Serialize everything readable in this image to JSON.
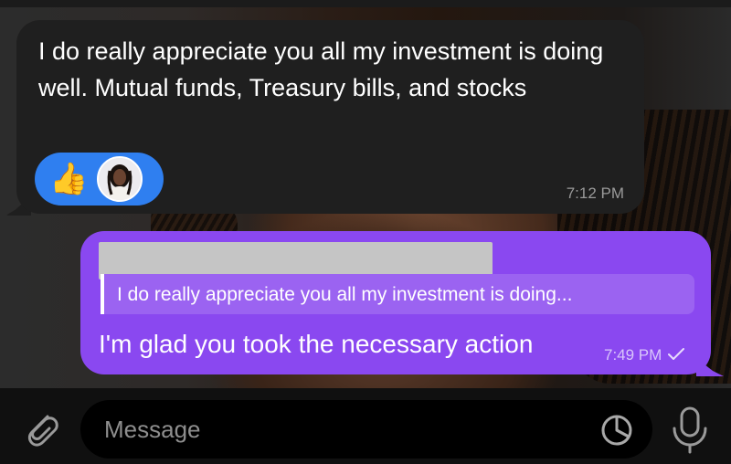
{
  "chat": {
    "incoming": {
      "text": "I do really appreciate you all my investment is doing well. Mutual funds, Treasury bills, and stocks",
      "time": "7:12 PM",
      "reaction_emoji": "👍",
      "reaction_icon": "thumbs-up-icon",
      "reaction_color": "#2f7ff0"
    },
    "outgoing": {
      "reply_quote": "I do really appreciate you all my investment is doing...",
      "text": "I'm glad you took the necessary action",
      "time": "7:49 PM",
      "status_icon": "single-check-icon",
      "bubble_color": "#8a48f0"
    }
  },
  "input": {
    "placeholder": "Message"
  }
}
